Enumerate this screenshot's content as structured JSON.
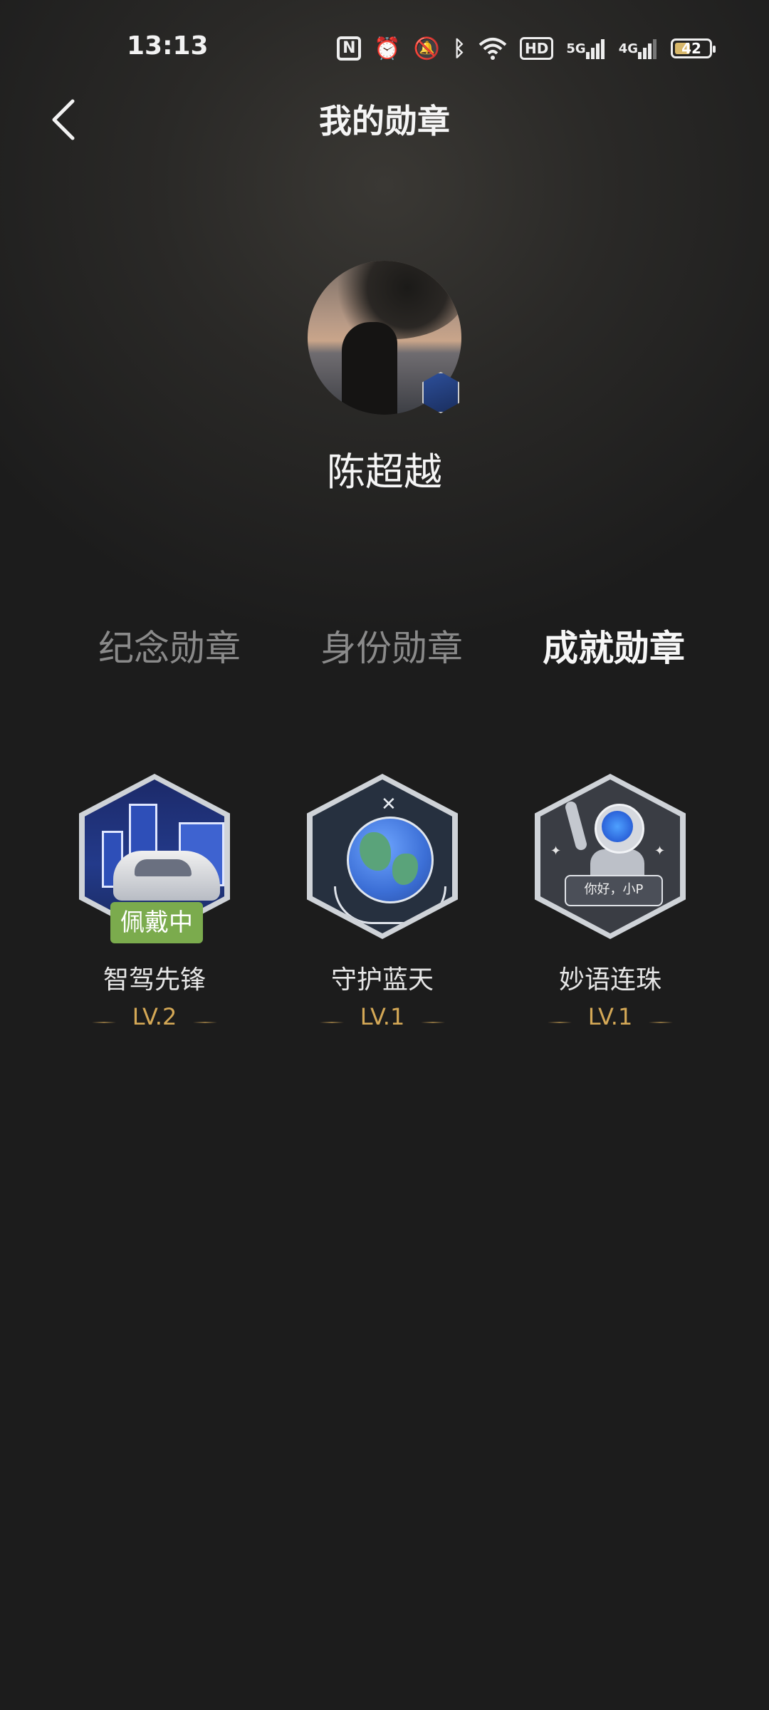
{
  "status_bar": {
    "time": "13:13",
    "hd_label": "HD",
    "net1_label": "5G",
    "net2_label": "4G",
    "battery_level": "42"
  },
  "header": {
    "title": "我的勋章"
  },
  "profile": {
    "username": "陈超越"
  },
  "tabs": [
    {
      "label": "纪念勋章",
      "active": false
    },
    {
      "label": "身份勋章",
      "active": false
    },
    {
      "label": "成就勋章",
      "active": true
    }
  ],
  "badges": [
    {
      "name": "智驾先锋",
      "level": "LV.2",
      "wearing_label": "佩戴中"
    },
    {
      "name": "守护蓝天",
      "level": "LV.1"
    },
    {
      "name": "妙语连珠",
      "level": "LV.1",
      "speech_text": "你好，小P"
    }
  ],
  "colors": {
    "background": "#1c1c1c",
    "accent_gold": "#d4a856",
    "wearing_green": "#7bab4d"
  }
}
